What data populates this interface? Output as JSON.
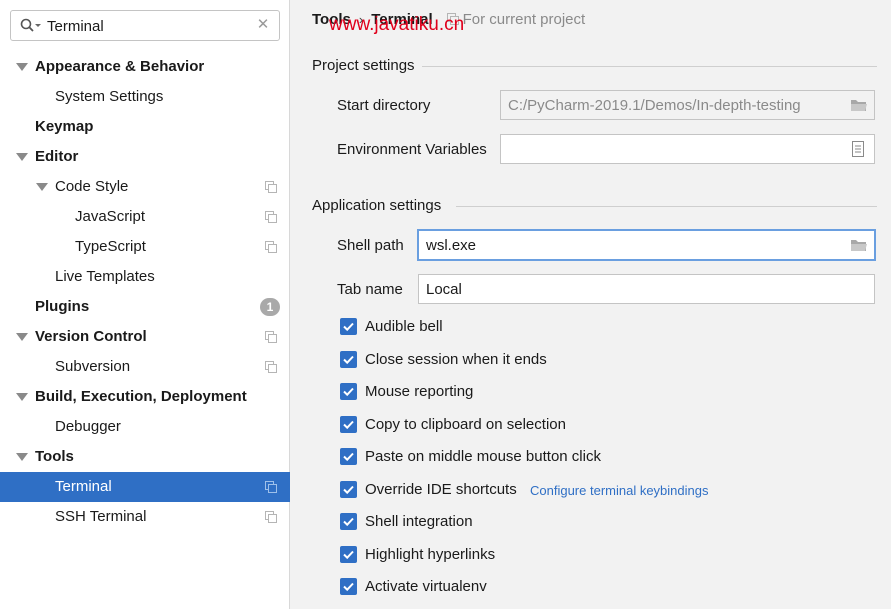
{
  "search": {
    "value": "Terminal"
  },
  "sidebar": {
    "items": [
      {
        "label": "Appearance & Behavior",
        "bold": true,
        "expanded": true,
        "level": 0,
        "copy": false
      },
      {
        "label": "System Settings",
        "bold": false,
        "level": 1,
        "copy": false
      },
      {
        "label": "Keymap",
        "bold": true,
        "level": 0,
        "copy": false
      },
      {
        "label": "Editor",
        "bold": true,
        "expanded": true,
        "level": 0,
        "copy": false
      },
      {
        "label": "Code Style",
        "bold": false,
        "expanded": true,
        "level": 1,
        "copy": true
      },
      {
        "label": "JavaScript",
        "bold": false,
        "level": 2,
        "copy": true
      },
      {
        "label": "TypeScript",
        "bold": false,
        "level": 2,
        "copy": true
      },
      {
        "label": "Live Templates",
        "bold": false,
        "level": 1,
        "copy": false
      },
      {
        "label": "Plugins",
        "bold": true,
        "level": 0,
        "copy": false,
        "badge": "1"
      },
      {
        "label": "Version Control",
        "bold": true,
        "expanded": true,
        "level": 0,
        "copy": true
      },
      {
        "label": "Subversion",
        "bold": false,
        "level": 1,
        "copy": true
      },
      {
        "label": "Build, Execution, Deployment",
        "bold": true,
        "expanded": true,
        "level": 0,
        "copy": false
      },
      {
        "label": "Debugger",
        "bold": false,
        "level": 1,
        "copy": false
      },
      {
        "label": "Tools",
        "bold": true,
        "expanded": true,
        "level": 0,
        "copy": false
      },
      {
        "label": "Terminal",
        "bold": false,
        "level": 1,
        "copy": true,
        "selected": true
      },
      {
        "label": "SSH Terminal",
        "bold": false,
        "level": 1,
        "copy": true
      }
    ]
  },
  "breadcrumb": {
    "parent": "Tools",
    "current": "Terminal",
    "scope": "For current project"
  },
  "watermark": "www.javatiku.cn",
  "project_settings": {
    "title": "Project settings",
    "start_directory_label": "Start directory",
    "start_directory_value": "C:/PyCharm-2019.1/Demos/In-depth-testing",
    "env_vars_label": "Environment Variables",
    "env_vars_value": ""
  },
  "application_settings": {
    "title": "Application settings",
    "shell_path_label": "Shell path",
    "shell_path_value": "wsl.exe",
    "tab_name_label": "Tab name",
    "tab_name_value": "Local",
    "checkboxes": [
      {
        "label": "Audible bell",
        "checked": true
      },
      {
        "label": "Close session when it ends",
        "checked": true
      },
      {
        "label": "Mouse reporting",
        "checked": true
      },
      {
        "label": "Copy to clipboard on selection",
        "checked": true
      },
      {
        "label": "Paste on middle mouse button click",
        "checked": true
      },
      {
        "label": "Override IDE shortcuts",
        "checked": true
      },
      {
        "label": "Shell integration",
        "checked": true
      },
      {
        "label": "Highlight hyperlinks",
        "checked": true
      },
      {
        "label": "Activate virtualenv",
        "checked": true
      }
    ],
    "keybindings_link": "Configure terminal keybindings"
  },
  "colors": {
    "accent": "#2f6fc5",
    "selection": "#2f6fc5",
    "watermark": "#e0001c"
  }
}
